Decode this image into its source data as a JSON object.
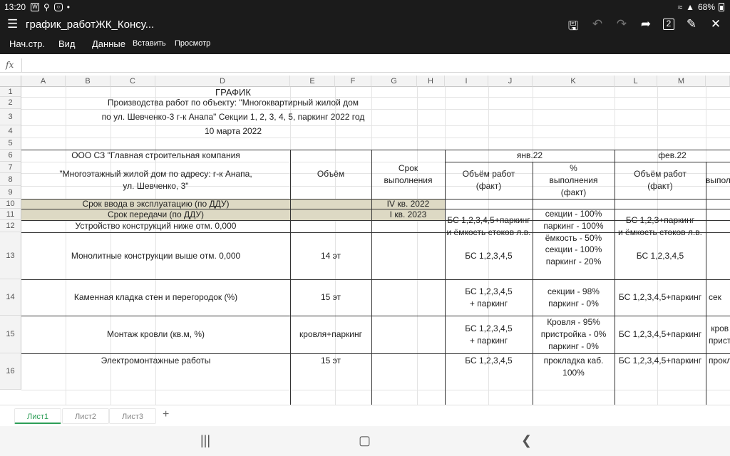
{
  "status": {
    "time": "13:20",
    "battery": "68%"
  },
  "app": {
    "doc_title": "график_работЖК_Консу...",
    "ribbon": [
      "Нач.стр.",
      "Вид",
      "Данные",
      "Вставить",
      "Просмотр"
    ],
    "fx_label": "fx"
  },
  "columns": [
    "A",
    "B",
    "C",
    "D",
    "E",
    "F",
    "G",
    "H",
    "I",
    "J",
    "K",
    "L",
    "M"
  ],
  "rows": [
    "1",
    "2",
    "3",
    "4",
    "5",
    "6",
    "7",
    "8",
    "9",
    "10",
    "11",
    "12",
    "13",
    "14",
    "15",
    "16"
  ],
  "header": {
    "title": "ГРАФИК",
    "line2": "Производства работ по объекту: \"Многоквартирный жилой дом",
    "line3": "по ул. Шевченко-3  г-к Анапа\" Секции 1, 2, 3, 4, 5, паркинг  2022 год",
    "date": "10 марта 2022",
    "company": "ООО СЗ \"Главная строительная компания",
    "object": "\"Многоэтажный жилой дом по адресу: г-к Анапа,\nул. Шевченко, 3\"",
    "volume": "Объём",
    "term": "Срок\nвыполнения",
    "jan": "янв.22",
    "feb": "фев.22",
    "fact": "Объём работ\n(факт)",
    "pct": "%\nвыполнения\n(факт)",
    "fact2": "Объём работ\n(факт)",
    "pct2_partial": "выпол"
  },
  "band_rows": [
    {
      "label": "Срок ввода в эксплуатацию (по ДДУ)",
      "term": "IV кв. 2022"
    },
    {
      "label": "Срок передачи (по ДДУ)",
      "term": "I кв. 2023"
    }
  ],
  "work_rows": [
    {
      "name": "Устройство конструкций ниже отм. 0,000",
      "volume": "",
      "jan_fact": "БС 1,2,3,4,5+паркинг\nи ёмкость стоков л.в.",
      "jan_pct": "секции - 100%\nпаркинг - 100%\nёмкость - 50%",
      "feb_fact": "БС 1,2,3+паркинг\nи ёмкость стоков л.в.",
      "feb_pct": ""
    },
    {
      "name": "Монолитные конструкции выше отм. 0,000",
      "volume": "14 эт",
      "jan_fact": "БС 1,2,3,4,5",
      "jan_pct": "секции - 100%\nпаркинг - 20%",
      "feb_fact": "БС 1,2,3,4,5",
      "feb_pct": ""
    },
    {
      "name": "Каменная кладка стен и перегородок (%)",
      "volume": "15 эт",
      "jan_fact": "БС 1,2,3,4,5\n+ паркинг",
      "jan_pct": "секции - 98%\nпаркинг - 0%",
      "feb_fact": "БС 1,2,3,4,5+паркинг",
      "feb_pct": "сек"
    },
    {
      "name": "Монтаж кровли (кв.м, %)",
      "volume": "кровля+паркинг",
      "jan_fact": "БС 1,2,3,4,5\n+ паркинг",
      "jan_pct": "Кровля - 95%\nпристройка - 0%\nпаркинг - 0%",
      "feb_fact": "БС 1,2,3,4,5+паркинг",
      "feb_pct": "кров\nприст"
    },
    {
      "name": "Электромонтажные работы",
      "volume": "15 эт",
      "jan_fact": "БС 1,2,3,4,5",
      "jan_pct": "прокладка каб.\n100%",
      "feb_fact": "БС 1,2,3,4,5+паркинг",
      "feb_pct": "прокл"
    }
  ],
  "sheets": [
    "Лист1",
    "Лист2",
    "Лист3"
  ]
}
